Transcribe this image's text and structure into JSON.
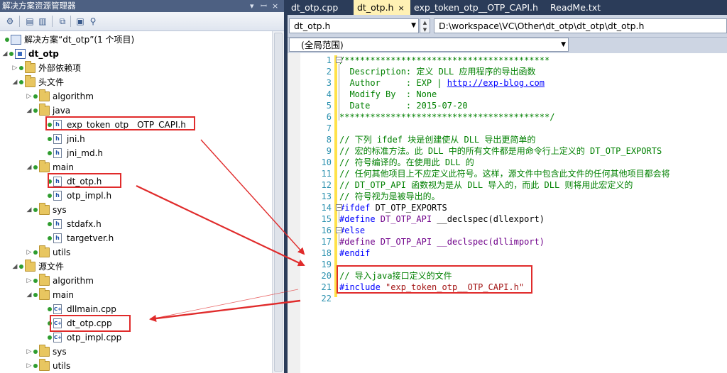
{
  "solution_explorer": {
    "title": "解决方案资源管理器",
    "pin_glyph": "▾ ♀ ×",
    "toolbar_icons": [
      "properties-icon",
      "show-all-files-icon",
      "refresh-icon",
      "view-code-icon",
      "view-designer-icon",
      "class-view-icon"
    ],
    "tree": [
      {
        "label": "解决方案“dt_otp”(1 个项目)",
        "level": 0,
        "kind": "solution",
        "toggle": "",
        "bold": false
      },
      {
        "label": "dt_otp",
        "level": 1,
        "kind": "project",
        "toggle": "◢",
        "bold": true
      },
      {
        "label": "外部依赖项",
        "level": 2,
        "kind": "folder",
        "toggle": "▷",
        "bold": false
      },
      {
        "label": "头文件",
        "level": 2,
        "kind": "folder",
        "toggle": "◢",
        "bold": false
      },
      {
        "label": "algorithm",
        "level": 3,
        "kind": "folder",
        "toggle": "▷",
        "bold": false
      },
      {
        "label": "java",
        "level": 3,
        "kind": "folder",
        "toggle": "◢",
        "bold": false
      },
      {
        "label": "exp_token_otp__OTP_CAPI.h",
        "level": 4,
        "kind": "h",
        "toggle": "",
        "bold": false
      },
      {
        "label": "jni.h",
        "level": 4,
        "kind": "h",
        "toggle": "",
        "bold": false
      },
      {
        "label": "jni_md.h",
        "level": 4,
        "kind": "h",
        "toggle": "",
        "bold": false
      },
      {
        "label": "main",
        "level": 3,
        "kind": "folder",
        "toggle": "◢",
        "bold": false
      },
      {
        "label": "dt_otp.h",
        "level": 4,
        "kind": "h",
        "toggle": "",
        "bold": false
      },
      {
        "label": "otp_impl.h",
        "level": 4,
        "kind": "h",
        "toggle": "",
        "bold": false
      },
      {
        "label": "sys",
        "level": 3,
        "kind": "folder",
        "toggle": "◢",
        "bold": false
      },
      {
        "label": "stdafx.h",
        "level": 4,
        "kind": "h",
        "toggle": "",
        "bold": false
      },
      {
        "label": "targetver.h",
        "level": 4,
        "kind": "h",
        "toggle": "",
        "bold": false
      },
      {
        "label": "utils",
        "level": 3,
        "kind": "folder",
        "toggle": "▷",
        "bold": false
      },
      {
        "label": "源文件",
        "level": 2,
        "kind": "folder",
        "toggle": "◢",
        "bold": false
      },
      {
        "label": "algorithm",
        "level": 3,
        "kind": "folder",
        "toggle": "▷",
        "bold": false
      },
      {
        "label": "main",
        "level": 3,
        "kind": "folder",
        "toggle": "◢",
        "bold": false
      },
      {
        "label": "dllmain.cpp",
        "level": 4,
        "kind": "cpp",
        "toggle": "",
        "bold": false
      },
      {
        "label": "dt_otp.cpp",
        "level": 4,
        "kind": "cpp",
        "toggle": "",
        "bold": false
      },
      {
        "label": "otp_impl.cpp",
        "level": 4,
        "kind": "cpp",
        "toggle": "",
        "bold": false
      },
      {
        "label": "sys",
        "level": 3,
        "kind": "folder",
        "toggle": "▷",
        "bold": false
      },
      {
        "label": "utils",
        "level": 3,
        "kind": "folder",
        "toggle": "▷",
        "bold": false
      }
    ]
  },
  "tabs": [
    {
      "label": "dt_otp.cpp",
      "active": false,
      "close": ""
    },
    {
      "label": "dt_otp.h",
      "active": true,
      "close": "×"
    },
    {
      "label": "exp_token_otp__OTP_CAPI.h",
      "active": false,
      "close": ""
    },
    {
      "label": "ReadMe.txt",
      "active": false,
      "close": ""
    }
  ],
  "navbar": {
    "file_combo": "dt_otp.h",
    "path_combo": "D:\\workspace\\VC\\Other\\dt_otp\\dt_otp\\dt_otp.h",
    "scope_combo": "(全局范围)"
  },
  "code_lines": [
    [
      {
        "t": "/****************************************",
        "c": "cm"
      }
    ],
    [
      {
        "t": "  Description: 定义 DLL 应用程序的导出函数",
        "c": "cm"
      }
    ],
    [
      {
        "t": "  Author     : EXP | ",
        "c": "cm"
      },
      {
        "t": "http://exp-blog.com",
        "c": "lnk"
      }
    ],
    [
      {
        "t": "  Modify By  : None",
        "c": "cm"
      }
    ],
    [
      {
        "t": "  Date       : 2015-07-20",
        "c": "cm"
      }
    ],
    [
      {
        "t": "*****************************************/",
        "c": "cm"
      }
    ],
    [
      {
        "t": "",
        "c": ""
      }
    ],
    [
      {
        "t": "// 下列 ifdef 块是创建使从 DLL 导出更简单的",
        "c": "cm"
      }
    ],
    [
      {
        "t": "// 宏的标准方法。此 DLL 中的所有文件都是用命令行上定义的 DT_OTP_EXPORTS",
        "c": "cm"
      }
    ],
    [
      {
        "t": "// 符号编译的。在使用此 DLL 的",
        "c": "cm"
      }
    ],
    [
      {
        "t": "// 任何其他项目上不应定义此符号。这样，源文件中包含此文件的任何其他项目都会将",
        "c": "cm"
      }
    ],
    [
      {
        "t": "// DT_OTP_API 函数视为是从 DLL 导入的，而此 DLL 则将用此宏定义的",
        "c": "cm"
      }
    ],
    [
      {
        "t": "// 符号视为是被导出的。",
        "c": "cm"
      }
    ],
    [
      {
        "t": "#ifdef",
        "c": "pp"
      },
      {
        "t": " DT_OTP_EXPORTS",
        "c": ""
      }
    ],
    [
      {
        "t": "#define",
        "c": "pp"
      },
      {
        "t": " DT_OTP_API",
        "c": "mac"
      },
      {
        "t": " __declspec(dllexport)",
        "c": ""
      }
    ],
    [
      {
        "t": "#else",
        "c": "pp"
      }
    ],
    [
      {
        "t": "#define DT_OTP_API __declspec(dllimport)",
        "c": "mac"
      }
    ],
    [
      {
        "t": "#endif",
        "c": "pp"
      }
    ],
    [
      {
        "t": "",
        "c": ""
      }
    ],
    [
      {
        "t": "// 导入java接口定义的文件",
        "c": "cm"
      }
    ],
    [
      {
        "t": "#include",
        "c": "pp"
      },
      {
        "t": " \"exp_token_otp__OTP_CAPI.h\"",
        "c": "str"
      }
    ],
    [
      {
        "t": "",
        "c": ""
      }
    ]
  ],
  "colors": {
    "annotation": "#e02b2b",
    "title_bar": "#4d6082",
    "active_tab": "#fff1b4"
  }
}
